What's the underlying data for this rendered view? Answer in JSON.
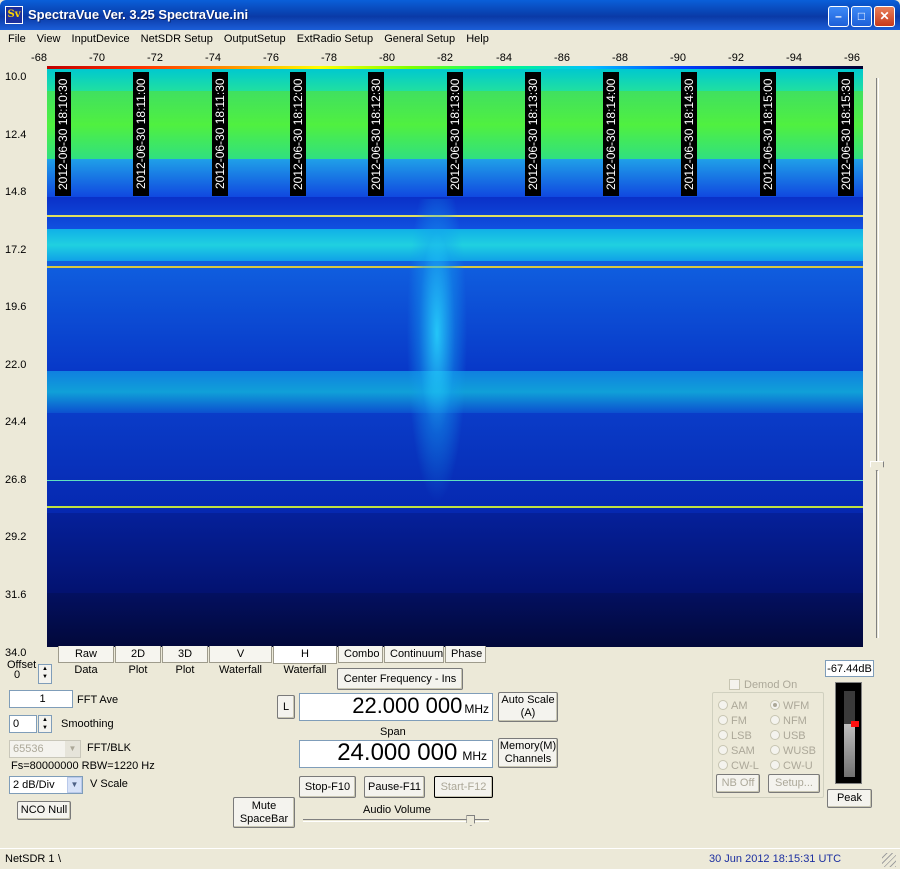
{
  "window": {
    "title": "SpectraVue Ver. 3.25  SpectraVue.ini",
    "icon_text": "Sv"
  },
  "menu": [
    "File",
    "View",
    "InputDevice",
    "NetSDR Setup",
    "OutputSetup",
    "ExtRadio Setup",
    "General Setup",
    "Help"
  ],
  "freq_axis": [
    "-68",
    "-70",
    "-72",
    "-74",
    "-76",
    "-78",
    "-80",
    "-82",
    "-84",
    "-86",
    "-88",
    "-90",
    "-92",
    "-94",
    "-96"
  ],
  "time_axis": [
    "10.0",
    "12.4",
    "14.8",
    "17.2",
    "19.6",
    "22.0",
    "24.4",
    "26.8",
    "29.2",
    "31.6",
    "34.0"
  ],
  "timestamps": [
    "2012-06-30 18:10:30",
    "2012-06-30 18:11:00",
    "2012-06-30 18:11:30",
    "2012-06-30 18:12:00",
    "2012-06-30 18:12:30",
    "2012-06-30 18:13:00",
    "2012-06-30 18:13:30",
    "2012-06-30 18:14:00",
    "2012-06-30 18:14:30",
    "2012-06-30 18:15:00",
    "2012-06-30 18:15:30"
  ],
  "tabs": [
    "Raw Data",
    "2D Plot",
    "3D Plot",
    "V Waterfall",
    "H Waterfall",
    "Combo",
    "Continuum",
    "Phase"
  ],
  "selected_tab": "H Waterfall",
  "controls": {
    "offset_label": "Offset",
    "offset_value": "0",
    "fft_ave_value": "1",
    "fft_ave_label": "FFT Ave",
    "smoothing_value": "0",
    "smoothing_label": "Smoothing",
    "fft_blk_value": "65536",
    "fft_blk_label": "FFT/BLK",
    "fs_text": "Fs=80000000 RBW=1220 Hz",
    "vscale_value": "2 dB/Div",
    "vscale_label": "V Scale",
    "nco_null": "NCO Null",
    "mute": "Mute\nSpaceBar"
  },
  "center": {
    "button": "Center Frequency - Ins",
    "l_button": "L",
    "frequency": "22.000 000",
    "unit": "MHz",
    "autoscale": "Auto Scale\n(A)",
    "span_label": "Span",
    "span": "24.000 000",
    "span_unit": "MHz",
    "memory": "Memory(M)\nChannels",
    "stop": "Stop-F10",
    "pause": "Pause-F11",
    "start": "Start-F12",
    "audio_label": "Audio Volume",
    "audio_volume": 0.9
  },
  "demod": {
    "label": "Demod On",
    "modes": [
      "AM",
      "WFM",
      "FM",
      "NFM",
      "LSB",
      "USB",
      "SAM",
      "WUSB",
      "CW-L",
      "CW-U"
    ],
    "selected": "WFM",
    "nb_off": "NB Off",
    "setup": "Setup..."
  },
  "meter": {
    "reading": "-67.44dB",
    "peak": "Peak",
    "level": 0.62
  },
  "status": {
    "left": "NetSDR 1",
    "sep": "\\",
    "datetime": "30 Jun 2012  18:15:31 UTC"
  },
  "colors": {
    "title_bar": "#0a46c0",
    "waterfall_bg": "#05127a",
    "signal": "#20c8ff"
  }
}
